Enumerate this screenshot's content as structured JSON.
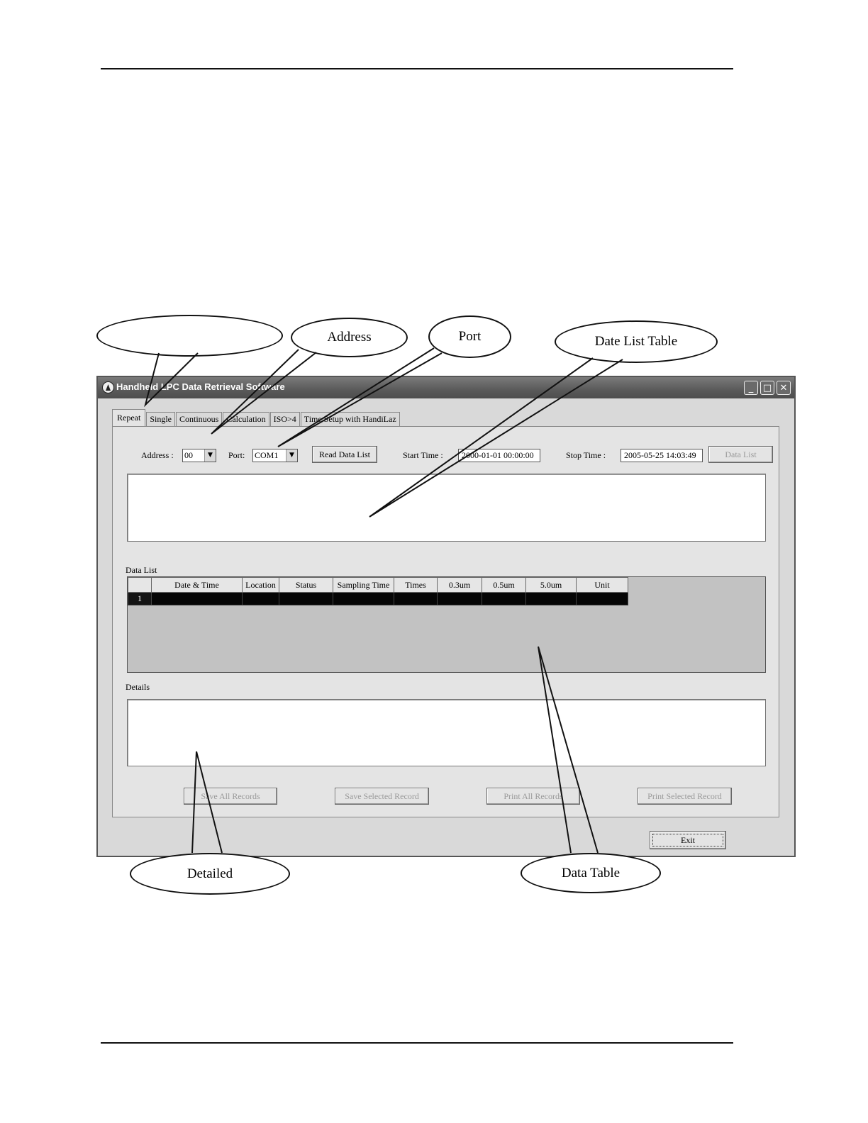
{
  "callouts": {
    "tabs": "",
    "address": "Address",
    "port": "Port",
    "date_list_table": "Date List Table",
    "detailed": "Detailed",
    "data_table": "Data Table"
  },
  "window": {
    "title": "Handheld LPC Data Retrieval Software",
    "controls": {
      "minimize": "_",
      "maximize": "□",
      "close": "✕"
    }
  },
  "tabs": [
    "Repeat",
    "Single",
    "Continuous",
    "Calculation",
    "ISO>4",
    "Time Setup with HandiLaz"
  ],
  "controls": {
    "address_label": "Address :",
    "address_value": "00",
    "port_label": "Port:",
    "port_value": "COM1",
    "read_button": "Read Data List",
    "start_label": "Start Time :",
    "start_value": "2000-01-01 00:00:00",
    "stop_label": "Stop Time :",
    "stop_value": "2005-05-25 14:03:49",
    "data_list_button": "Data List"
  },
  "data_list": {
    "label": "Data List",
    "columns": [
      "Date & Time",
      "Location",
      "Status",
      "Sampling Time",
      "Times",
      "0.3um",
      "0.5um",
      "5.0um",
      "Unit"
    ],
    "rows": [
      {
        "header": "1",
        "cells": [
          "",
          "",
          "",
          "",
          "",
          "",
          "",
          "",
          ""
        ]
      }
    ]
  },
  "details": {
    "label": "Details"
  },
  "bottom_buttons": {
    "save_all": "Save All Records",
    "save_selected": "Save Selected Record",
    "print_all": "Print All Records",
    "print_selected": "Print Selected Record"
  },
  "exit_button": "Exit"
}
